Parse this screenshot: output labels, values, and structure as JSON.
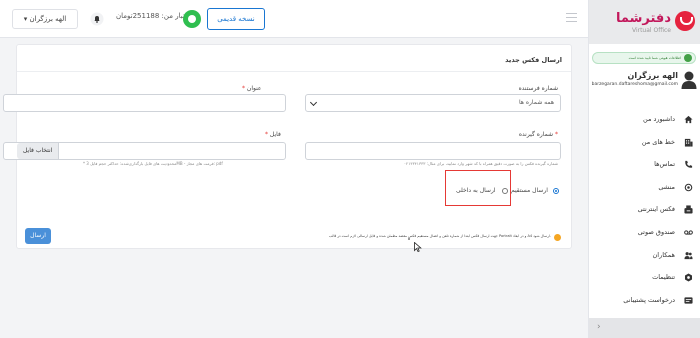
{
  "header": {
    "user_menu_label": "الهه برزگران",
    "credit_text": "اعتبار من: 251188تومان",
    "old_version_label": "نسخه قدیمی"
  },
  "sidebar": {
    "logo_text": "دفترشما",
    "logo_subtitle": "Virtual Office",
    "verified_text": "اطلاعات هویتی شما تایید شده است",
    "profile_name": "الهه برزگران",
    "profile_email": "barzegaran.daftareshoma@gmail.com",
    "items": [
      {
        "label": "داشبورد من",
        "icon": "home-icon"
      },
      {
        "label": "خط های من",
        "icon": "building-icon"
      },
      {
        "label": "تماس‌ها",
        "icon": "phone-icon"
      },
      {
        "label": "منشی",
        "icon": "headset-icon"
      },
      {
        "label": "فکس اینترنتی",
        "icon": "fax-icon"
      },
      {
        "label": "صندوق صوتی",
        "icon": "voicemail-icon"
      },
      {
        "label": "همکاران",
        "icon": "users-icon"
      },
      {
        "label": "تنظیمات",
        "icon": "gear-icon"
      },
      {
        "label": "درخواست پشتیبانی",
        "icon": "ticket-icon"
      }
    ],
    "collapse_glyph": "›"
  },
  "form": {
    "title": "ارسال فکس جدید",
    "sender_label": "شماره فرستنده",
    "sender_value": "همه شماره ها",
    "subject_label": "عنوان",
    "receiver_label": "شماره گیرنده",
    "receiver_hint": "شماره گیرنده فکس را به صورت دقیق همراه با کد شهر وارد نمایید، برای مثال: ۰۲۱۴۳۴۱۳۳۳",
    "file_label": "فایل",
    "file_button": "انتخاب فایل",
    "file_hint": "* محدودیت های فایل بارگذاری‌شده: حداکثر حجم فایل 3MB - فرمت های مجاز: pdf",
    "radio_direct": "ارسال مستقیم",
    "radio_internal": "ارسال به داخلی",
    "note": "جهت ارسال فکس ابتدا از شماره تلفن و اتصال مستقیم فکس مقصد مطمئن شده و فایل ارسالی لازم است در قالب Portrait و در ابعاد A4 ارسال شود.",
    "send_button": "ارسال",
    "required_mark": "*"
  },
  "colors": {
    "brand": "#e5233e",
    "accent": "#1976d2",
    "send_button": "#4a90d9",
    "highlight_box": "#e53935",
    "verified": "#43a047"
  }
}
